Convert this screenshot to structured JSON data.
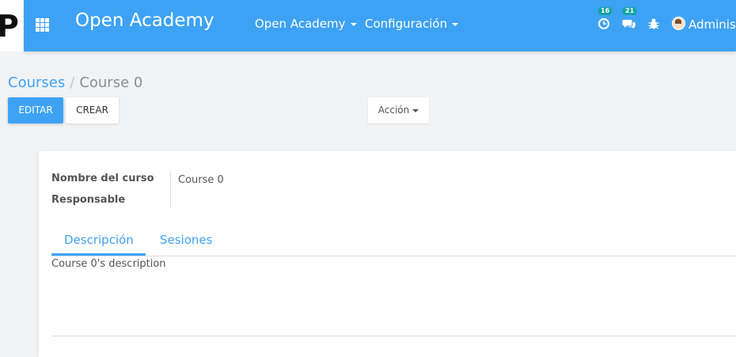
{
  "navbar": {
    "brand": "Open Academy",
    "menus": [
      {
        "label": "Open Academy"
      },
      {
        "label": "Configuración"
      }
    ],
    "activity_count": "16",
    "messages_count": "21",
    "user_name": "Administ",
    "colors": {
      "accent": "#3ea2f4",
      "badge": "#12a5a0"
    }
  },
  "logo": {
    "text": "P"
  },
  "breadcrumb": {
    "parent": "Courses",
    "separator": "/",
    "current": "Course 0"
  },
  "buttons": {
    "edit": "EDITAR",
    "create": "CREAR",
    "action": "Acción"
  },
  "form": {
    "fields": [
      {
        "label": "Nombre del curso",
        "value": "Course 0"
      },
      {
        "label": "Responsable",
        "value": ""
      }
    ],
    "tabs": [
      {
        "label": "Descripción",
        "active": true
      },
      {
        "label": "Sesiones",
        "active": false
      }
    ],
    "description": "Course 0's description"
  }
}
